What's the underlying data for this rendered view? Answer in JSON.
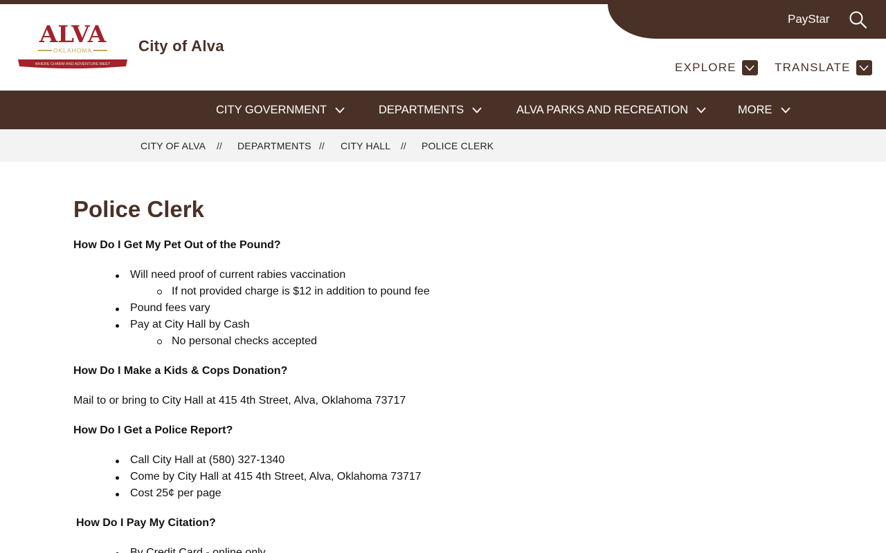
{
  "header": {
    "site_title": "City of Alva",
    "logo": {
      "name": "ALVA",
      "state": "OKLAHOMA",
      "tagline": "WHERE CHARM AND ADVENTURE MEET"
    },
    "paystar": "PayStar",
    "search_icon": "search-icon",
    "explore": "EXPLORE",
    "translate": "TRANSLATE"
  },
  "nav": {
    "items": [
      {
        "label": "CITY GOVERNMENT"
      },
      {
        "label": "DEPARTMENTS"
      },
      {
        "label": "ALVA PARKS AND RECREATION"
      },
      {
        "label": "MORE"
      }
    ]
  },
  "breadcrumb": {
    "items": [
      "CITY OF ALVA",
      "DEPARTMENTS",
      "CITY HALL",
      "POLICE CLERK"
    ],
    "separator": "//"
  },
  "content": {
    "title": "Police Clerk",
    "q1": "How Do I Get My Pet Out of the Pound?",
    "q1_items": [
      "Will need proof of current rabies vaccination",
      "If not provided charge is $12 in addition to pound fee",
      "Pound fees vary",
      "Pay at City Hall by Cash",
      "No personal checks accepted"
    ],
    "q2": "How Do I Make a Kids & Cops Donation?",
    "q2_text": "Mail to or bring to City Hall at 415 4th Street, Alva, Oklahoma 73717",
    "q3": "How Do I Get a Police Report?",
    "q3_items": [
      "Call City Hall at (580) 327-1340",
      "Come by City Hall at 415 4th Street, Alva, Oklahoma 73717",
      "Cost 25¢ per page"
    ],
    "q4": "How Do I Pay My Citation?",
    "q4_items": [
      "By Credit Card - online only"
    ]
  },
  "colors": {
    "brand": "#4a3128",
    "logo_red": "#a3222b",
    "logo_gold": "#c9a45a",
    "breadcrumb_bg": "#f3f3f3"
  }
}
